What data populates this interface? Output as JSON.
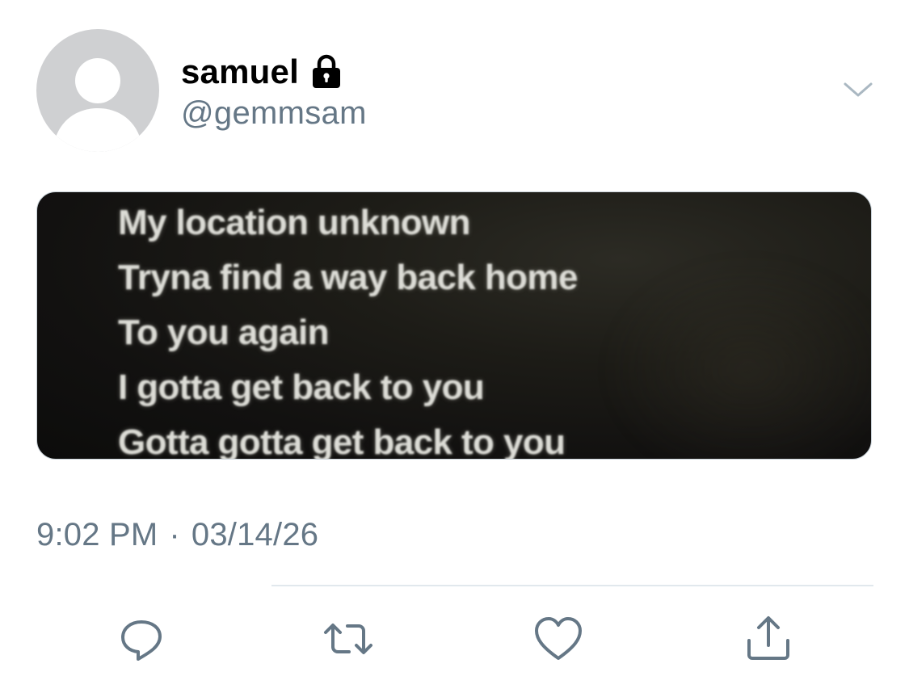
{
  "profile": {
    "display_name": "samuel",
    "handle": "@gemmsam",
    "protected_icon": "lock-icon",
    "avatar_icon": "default-avatar-icon"
  },
  "header": {
    "menu_icon": "chevron-down-icon"
  },
  "media": {
    "lyrics": [
      "My location unknown",
      "Tryna find a way back home",
      "To you again",
      "I gotta get back to you",
      "Gotta gotta get back to you"
    ]
  },
  "tweet": {
    "time": "9:02 PM",
    "separator": "·",
    "date": "03/14/26"
  },
  "actions": [
    {
      "name": "reply",
      "icon": "reply-icon"
    },
    {
      "name": "retweet",
      "icon": "retweet-icon"
    },
    {
      "name": "like",
      "icon": "heart-icon"
    },
    {
      "name": "share",
      "icon": "share-icon"
    }
  ],
  "colors": {
    "secondary_text": "#657786",
    "icon": "#657786",
    "divider": "#e1e8ed",
    "avatar_bg": "#cfd0d2"
  }
}
